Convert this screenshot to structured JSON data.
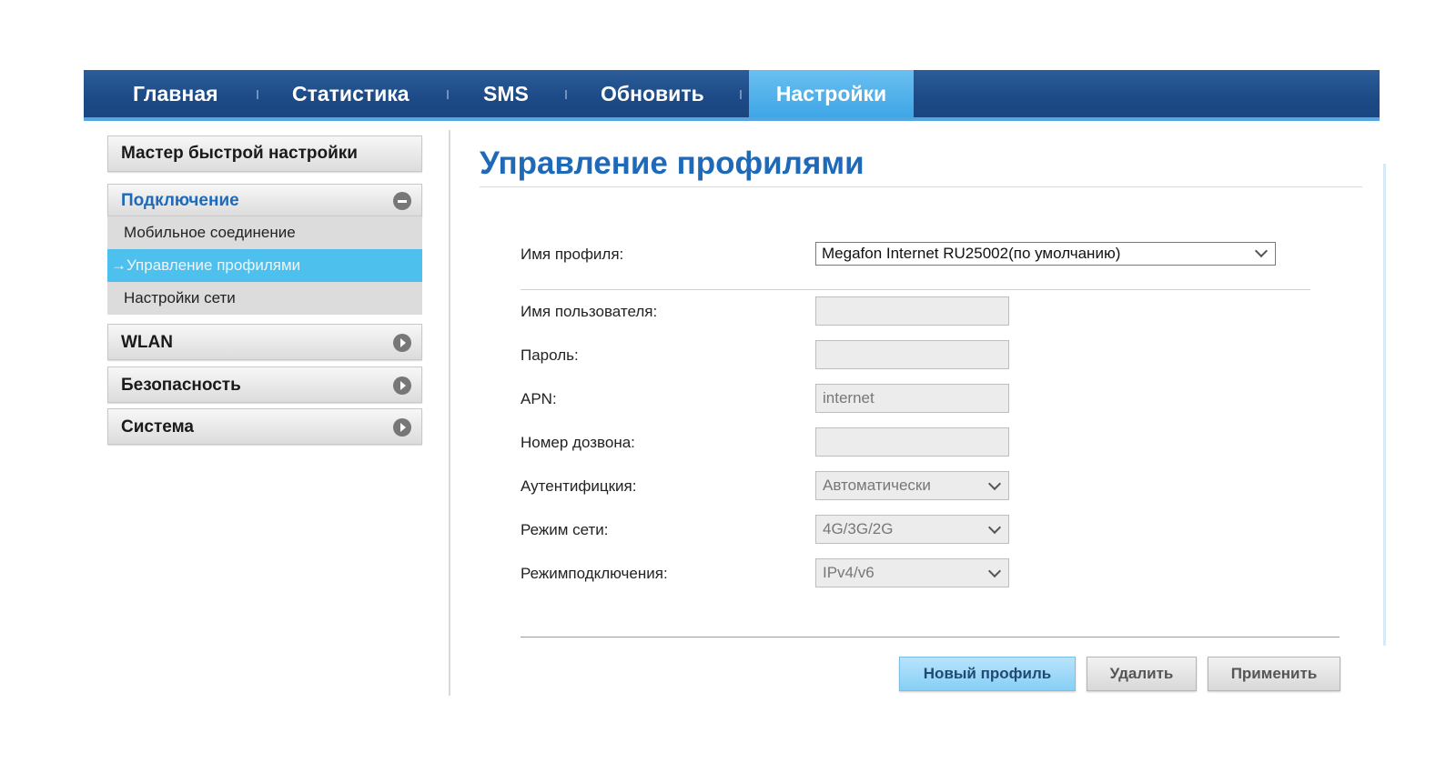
{
  "nav": {
    "items": [
      {
        "label": "Главная",
        "active": false
      },
      {
        "label": "Статистика",
        "active": false
      },
      {
        "label": "SMS",
        "active": false
      },
      {
        "label": "Обновить",
        "active": false
      },
      {
        "label": "Настройки",
        "active": true
      }
    ],
    "accent_color": "#3fa6e6",
    "bar_color": "#1c4a86"
  },
  "sidebar": {
    "quick_setup": "Мастер быстрой настройки",
    "sections": [
      {
        "label": "Подключение",
        "expanded": true,
        "icon": "minus-circle-icon",
        "items": [
          {
            "label": "Мобильное соединение",
            "active": false
          },
          {
            "label": "→Управление профилями",
            "active": true
          },
          {
            "label": "Настройки сети",
            "active": false
          }
        ]
      },
      {
        "label": "WLAN",
        "expanded": false,
        "icon": "arrow-circle-icon"
      },
      {
        "label": "Безопасность",
        "expanded": false,
        "icon": "arrow-circle-icon"
      },
      {
        "label": "Система",
        "expanded": false,
        "icon": "arrow-circle-icon"
      }
    ]
  },
  "main": {
    "title": "Управление профилями",
    "title_color": "#1e6ab9",
    "profile": {
      "label": "Имя профиля:",
      "value": "Megafon Internet RU25002(по умолчанию)"
    },
    "fields": {
      "username": {
        "label": "Имя пользователя:",
        "value": ""
      },
      "password": {
        "label": "Пароль:",
        "value": ""
      },
      "apn": {
        "label": "APN:",
        "value": "internet"
      },
      "dial_number": {
        "label": "Номер дозвона:",
        "value": ""
      },
      "auth": {
        "label": "Аутентифицкия:",
        "value": "Автоматически"
      },
      "network_mode": {
        "label": "Режим сети:",
        "value": "4G/3G/2G"
      },
      "connection_mode": {
        "label": "Режимподключения:",
        "value": "IPv4/v6"
      }
    },
    "buttons": {
      "new_profile": "Новый профиль",
      "delete": "Удалить",
      "apply": "Применить"
    }
  }
}
